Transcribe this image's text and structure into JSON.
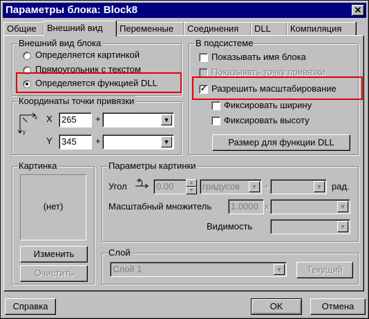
{
  "window": {
    "title": "Параметры блока: Block8",
    "close_glyph": "✕"
  },
  "tabs": [
    {
      "label": "Общие"
    },
    {
      "label": "Внешний вид"
    },
    {
      "label": "Переменные"
    },
    {
      "label": "Соединения"
    },
    {
      "label": "DLL"
    },
    {
      "label": "Компиляция"
    }
  ],
  "appearance": {
    "title": "Внешний вид блока",
    "options": [
      {
        "label": "Определяется картинкой"
      },
      {
        "label": "Прямоугольник с текстом"
      },
      {
        "label": "Определяется функцией DLL"
      }
    ],
    "selected": "Определяется функцией DLL"
  },
  "anchor": {
    "title": "Координаты точки привязки",
    "x_label": "X",
    "x_value": "265",
    "y_label": "Y",
    "y_value": "345",
    "plus": "+",
    "axis_x": "x",
    "axis_y": "y"
  },
  "subsystem": {
    "title": "В подсистеме",
    "show_name": "Показывать имя блока",
    "show_anchor": "Показывать точку привязки",
    "allow_scale": "Разрешить масштабирование",
    "fix_width": "Фиксировать ширину",
    "fix_height": "Фиксировать высоту",
    "dll_size_button": "Размер для функции DLL",
    "allow_scale_checked": true,
    "check_glyph": "✓"
  },
  "picture": {
    "title": "Картинка",
    "placeholder": "(нет)",
    "change_button": "Изменить",
    "clear_button": "Очистить"
  },
  "picture_params": {
    "title": "Параметры картинки",
    "angle_label": "Угол",
    "angle_value": "0.00",
    "angle_unit": "градусов",
    "plus": "+",
    "rad_label": "рад.",
    "scale_label": "Масштабный множитель",
    "scale_value": "1.0000",
    "times": "x",
    "visibility_label": "Видимость"
  },
  "layer": {
    "title": "Слой",
    "value": "Слой 1",
    "current_button": "Текущий"
  },
  "footer": {
    "help_button": "Справка",
    "ok_button": "OK",
    "cancel_button": "Отмена"
  },
  "icons": {
    "dropdown": "▼",
    "spin_up": "▲",
    "spin_down": "▼"
  },
  "colors": {
    "title_bar": "#000080",
    "face": "#c0c0c0",
    "highlight": "#e00000"
  }
}
